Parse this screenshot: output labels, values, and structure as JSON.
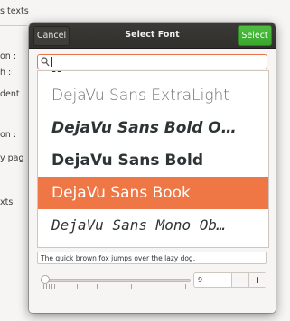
{
  "background": {
    "labels": [
      "s texts",
      "on :",
      "h :",
      "dent",
      "on :",
      "y pag",
      "xts"
    ]
  },
  "dialog": {
    "cancel_label": "Cancel",
    "title": "Select Font",
    "select_label": "Select",
    "search": {
      "value": ""
    },
    "fonts": [
      {
        "name": "DejaVu Sans ExtraLight",
        "style": "extralight"
      },
      {
        "name": "DejaVu Sans Bold Oblique",
        "display": "DejaVu Sans Bold O…",
        "style": "boldoblique"
      },
      {
        "name": "DejaVu Sans Bold",
        "style": "bold"
      },
      {
        "name": "DejaVu Sans Book",
        "style": "book",
        "selected": true
      },
      {
        "name": "DejaVu Sans Mono Oblique",
        "display": "DejaVu Sans Mono Ob…",
        "style": "monooblique"
      }
    ],
    "preview_text": "The quick brown fox jumps over the lazy dog.",
    "size": {
      "value": "9",
      "minus_label": "−",
      "plus_label": "+"
    },
    "accent_color": "#ef7745",
    "select_color": "#3aa72e"
  }
}
